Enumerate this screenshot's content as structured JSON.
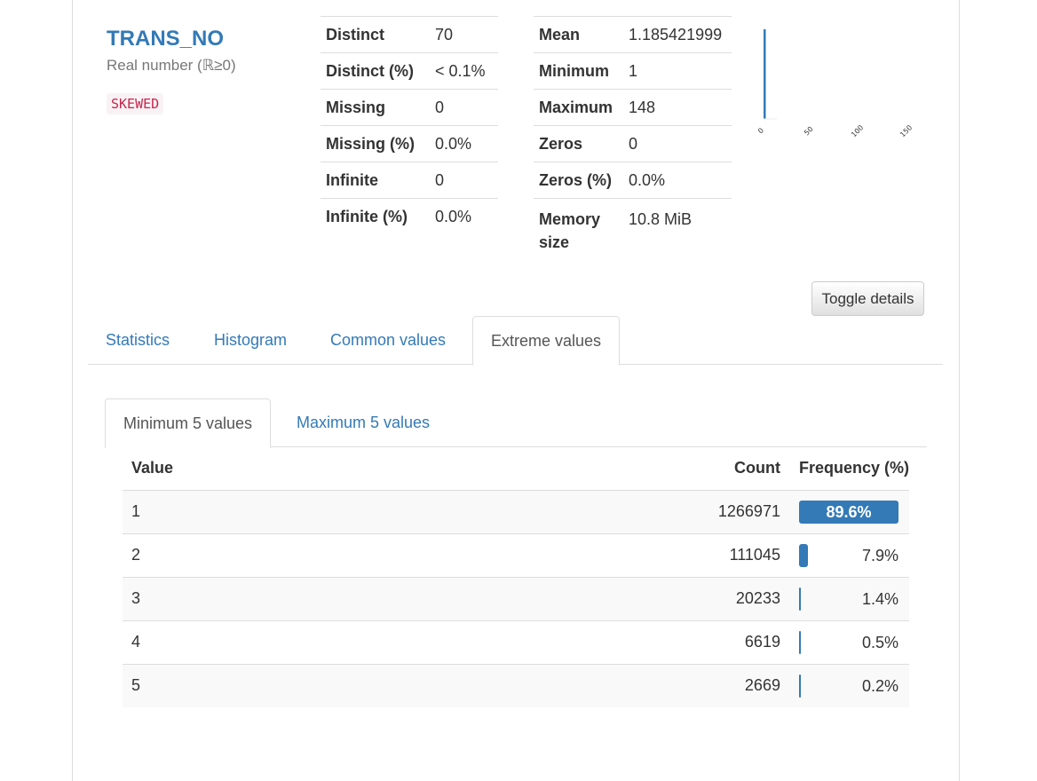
{
  "variable": {
    "name": "TRANS_NO",
    "type": "Real number (ℝ≥0)",
    "badge": "SKEWED"
  },
  "stats_left": [
    {
      "key": "Distinct",
      "value": "70"
    },
    {
      "key": "Distinct (%)",
      "value": "< 0.1%"
    },
    {
      "key": "Missing",
      "value": "0"
    },
    {
      "key": "Missing (%)",
      "value": "0.0%"
    },
    {
      "key": "Infinite",
      "value": "0"
    },
    {
      "key": "Infinite (%)",
      "value": "0.0%"
    }
  ],
  "stats_right": [
    {
      "key": "Mean",
      "value": "1.185421999"
    },
    {
      "key": "Minimum",
      "value": "1"
    },
    {
      "key": "Maximum",
      "value": "148"
    },
    {
      "key": "Zeros",
      "value": "0"
    },
    {
      "key": "Zeros (%)",
      "value": "0.0%"
    },
    {
      "key": "Memory size",
      "value": "10.8 MiB"
    }
  ],
  "mini_histogram": {
    "tick_labels": [
      "0",
      "50",
      "100",
      "150"
    ],
    "bar_color": "#337ab7"
  },
  "toggle_label": "Toggle details",
  "tabs": [
    "Statistics",
    "Histogram",
    "Common values",
    "Extreme values"
  ],
  "active_tab": "Extreme values",
  "subtabs": [
    "Minimum 5 values",
    "Maximum 5 values"
  ],
  "active_subtab": "Minimum 5 values",
  "table": {
    "headers": {
      "value": "Value",
      "count": "Count",
      "frequency": "Frequency (%)"
    },
    "rows": [
      {
        "value": "1",
        "count": "1266971",
        "freq_label": "89.6%",
        "freq": 89.6
      },
      {
        "value": "2",
        "count": "111045",
        "freq_label": "7.9%",
        "freq": 7.9
      },
      {
        "value": "3",
        "count": "20233",
        "freq_label": "1.4%",
        "freq": 1.4
      },
      {
        "value": "4",
        "count": "6619",
        "freq_label": "0.5%",
        "freq": 0.5
      },
      {
        "value": "5",
        "count": "2669",
        "freq_label": "0.2%",
        "freq": 0.2
      }
    ]
  },
  "colors": {
    "link": "#337ab7",
    "bar": "#337ab7",
    "badge_text": "#c7254e"
  }
}
